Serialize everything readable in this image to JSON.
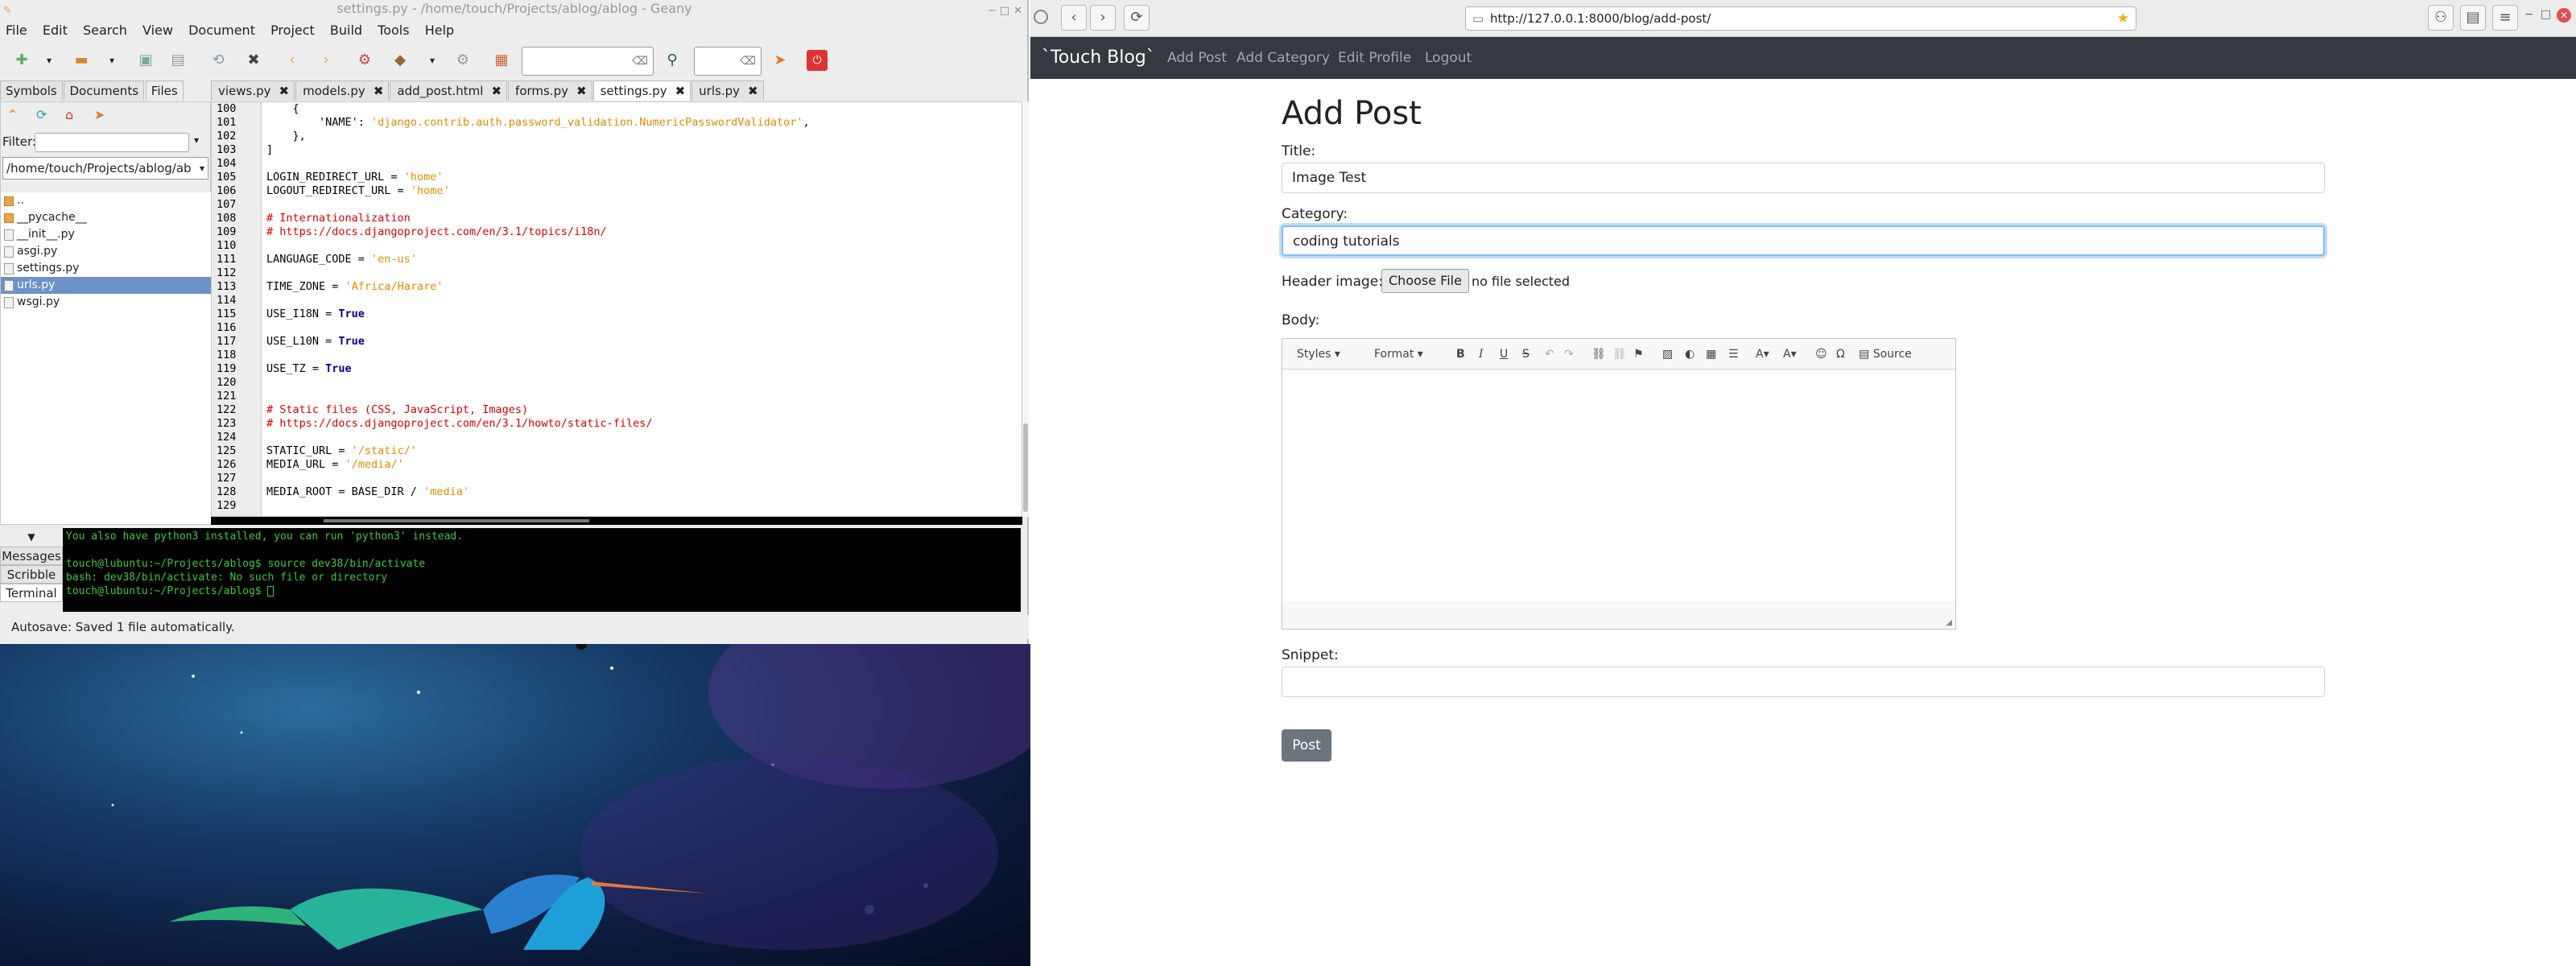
{
  "geany": {
    "title": "settings.py - /home/touch/Projects/ablog/ablog - Geany",
    "menu": [
      "File",
      "Edit",
      "Search",
      "View",
      "Document",
      "Project",
      "Build",
      "Tools",
      "Help"
    ],
    "sidebar_tabs": [
      "Symbols",
      "Documents",
      "Files"
    ],
    "filter_label": "Filter:",
    "path": "/home/touch/Projects/ablog/ab",
    "files": [
      "..",
      "__pycache__",
      "__init__.py",
      "asgi.py",
      "settings.py",
      "urls.py",
      "wsgi.py"
    ],
    "doc_tabs": [
      "views.py",
      "models.py",
      "add_post.html",
      "forms.py",
      "settings.py",
      "urls.py"
    ],
    "line_numbers": [
      "100",
      "101",
      "102",
      "103",
      "104",
      "105",
      "106",
      "107",
      "108",
      "109",
      "110",
      "111",
      "112",
      "113",
      "114",
      "115",
      "116",
      "117",
      "118",
      "119",
      "120",
      "121",
      "122",
      "123",
      "124",
      "125",
      "126",
      "127",
      "128",
      "129"
    ],
    "code": {
      "l100": "    {",
      "l101a": "        'NAME': ",
      "l101b": "'django.contrib.auth.password_validation.NumericPasswordValidator'",
      "l101c": ",",
      "l102": "    },",
      "l103": "]",
      "l105a": "LOGIN_REDIRECT_URL = ",
      "l105b": "'home'",
      "l106a": "LOGOUT_REDIRECT_URL = ",
      "l106b": "'home'",
      "l108": "# Internationalization",
      "l109": "# https://docs.djangoproject.com/en/3.1/topics/i18n/",
      "l111a": "LANGUAGE_CODE = ",
      "l111b": "'en-us'",
      "l113a": "TIME_ZONE = ",
      "l113b": "'Africa/Harare'",
      "l115a": "USE_I18N = ",
      "l115b": "True",
      "l117a": "USE_L10N = ",
      "l117b": "True",
      "l119a": "USE_TZ = ",
      "l119b": "True",
      "l122": "# Static files (CSS, JavaScript, Images)",
      "l123": "# https://docs.djangoproject.com/en/3.1/howto/static-files/",
      "l125a": "STATIC_URL = ",
      "l125b": "'/static/'",
      "l126a": "MEDIA_URL = ",
      "l126b": "'/media/'",
      "l128a": "MEDIA_ROOT = BASE_DIR / ",
      "l128b": "'media'"
    },
    "msg_tabs": [
      "Messages",
      "Scribble",
      "Terminal"
    ],
    "terminal": [
      "You also have python3 installed, you can run 'python3' instead.",
      "",
      "touch@lubuntu:~/Projects/ablog$ source dev38/bin/activate",
      "bash: dev38/bin/activate: No such file or directory",
      "touch@lubuntu:~/Projects/ablog$ "
    ],
    "status": "Autosave: Saved 1 file automatically."
  },
  "browser": {
    "url": "http://127.0.0.1:8000/blog/add-post/",
    "brand": "`Touch Blog`",
    "nav": [
      "Add Post",
      "Add Category",
      "Edit Profile",
      "Logout"
    ],
    "page_title": "Add Post",
    "title_label": "Title:",
    "title_value": "Image Test",
    "category_label": "Category:",
    "category_value": "coding tutorials",
    "header_label": "Header image:",
    "choose_file": "Choose File",
    "no_file": "no file selected",
    "body_label": "Body:",
    "ck_styles": "Styles",
    "ck_format": "Format",
    "ck_source": "Source",
    "snippet_label": "Snippet:",
    "post_button": "Post"
  }
}
